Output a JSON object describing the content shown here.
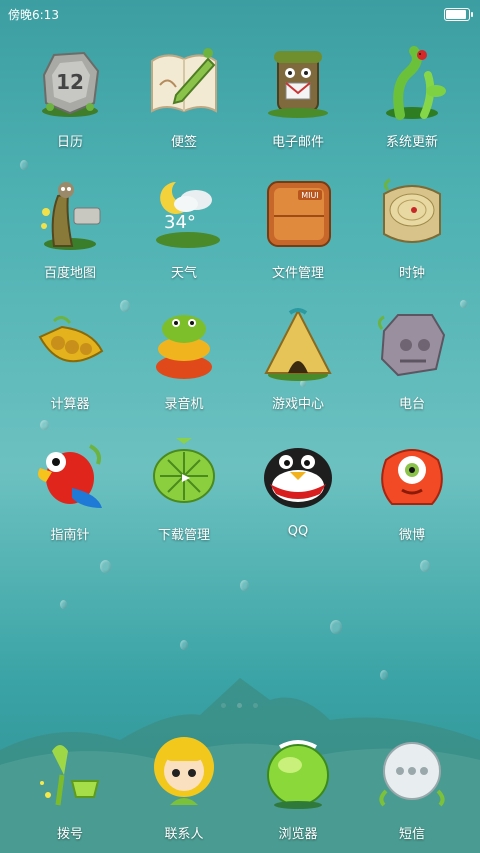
{
  "status": {
    "time": "傍晚6:13"
  },
  "apps": [
    {
      "label": "日历",
      "icon": "calendar-stone-icon",
      "number": "12"
    },
    {
      "label": "便签",
      "icon": "notes-scroll-icon"
    },
    {
      "label": "电子邮件",
      "icon": "mail-tree-icon"
    },
    {
      "label": "系统更新",
      "icon": "system-update-sprout-icon"
    },
    {
      "label": "百度地图",
      "icon": "map-tree-owl-icon"
    },
    {
      "label": "天气",
      "icon": "weather-moon-cloud-icon",
      "temperature": "34°"
    },
    {
      "label": "文件管理",
      "icon": "file-manager-box-icon",
      "brand": "MIUI"
    },
    {
      "label": "时钟",
      "icon": "clock-wood-stump-icon"
    },
    {
      "label": "计算器",
      "icon": "calculator-peapod-icon"
    },
    {
      "label": "录音机",
      "icon": "recorder-frog-stack-icon"
    },
    {
      "label": "游戏中心",
      "icon": "game-center-hut-icon"
    },
    {
      "label": "电台",
      "icon": "radio-stone-icon"
    },
    {
      "label": "指南针",
      "icon": "compass-parrot-icon"
    },
    {
      "label": "下载管理",
      "icon": "download-fish-icon"
    },
    {
      "label": "QQ",
      "icon": "qq-penguin-icon"
    },
    {
      "label": "微博",
      "icon": "weibo-monster-icon"
    }
  ],
  "dock": [
    {
      "label": "拨号",
      "icon": "dialer-sprout-icon"
    },
    {
      "label": "联系人",
      "icon": "contacts-doll-icon"
    },
    {
      "label": "浏览器",
      "icon": "browser-globe-icon"
    },
    {
      "label": "短信",
      "icon": "messages-bubble-icon"
    }
  ],
  "colors": {
    "background": "#4fb2b3",
    "label": "#ffffff"
  }
}
